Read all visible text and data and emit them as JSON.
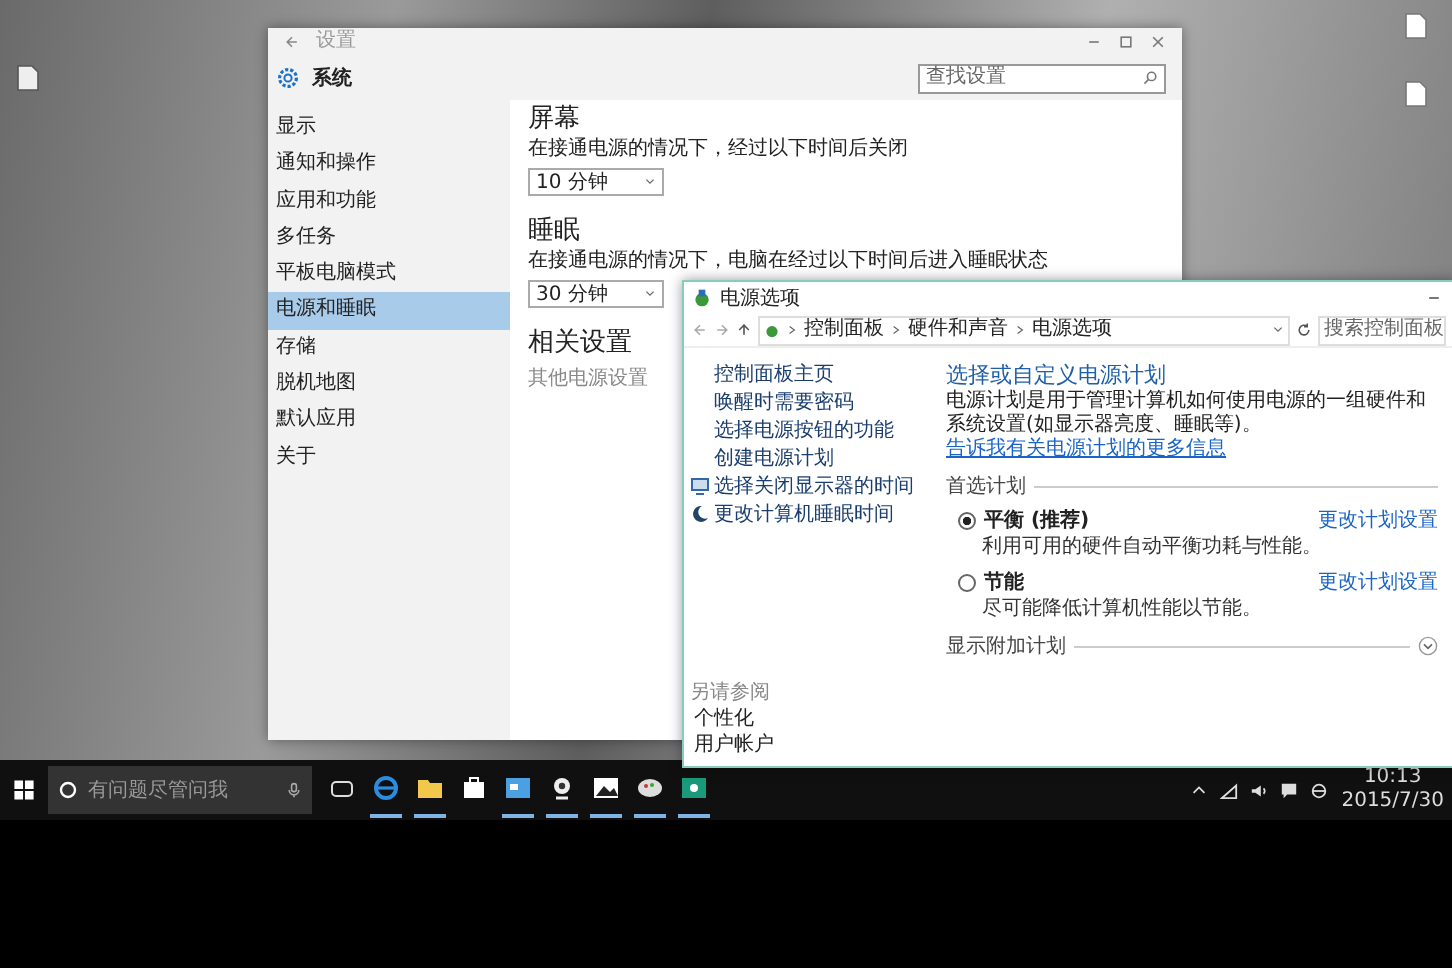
{
  "settings_window": {
    "title": "设置",
    "header": "系统",
    "search": {
      "placeholder": "查找设置"
    },
    "sidebar": {
      "items": [
        {
          "label": "显示",
          "selected": false
        },
        {
          "label": "通知和操作",
          "selected": false
        },
        {
          "label": "应用和功能",
          "selected": false
        },
        {
          "label": "多任务",
          "selected": false
        },
        {
          "label": "平板电脑模式",
          "selected": false
        },
        {
          "label": "电源和睡眠",
          "selected": true
        },
        {
          "label": "存储",
          "selected": false
        },
        {
          "label": "脱机地图",
          "selected": false
        },
        {
          "label": "默认应用",
          "selected": false
        },
        {
          "label": "关于",
          "selected": false
        }
      ]
    },
    "sections": [
      {
        "heading": "屏幕",
        "label": "在接通电源的情况下，经过以下时间后关闭",
        "dropdown": "10 分钟"
      },
      {
        "heading": "睡眠",
        "label": "在接通电源的情况下，电脑在经过以下时间后进入睡眠状态",
        "dropdown": "30 分钟"
      }
    ],
    "related": {
      "heading": "相关设置",
      "link": "其他电源设置"
    }
  },
  "control_panel": {
    "title": "电源选项",
    "breadcrumb": [
      "控制面板",
      "硬件和声音",
      "电源选项"
    ],
    "search": {
      "placeholder": "搜索控制面板"
    },
    "tasks": [
      {
        "label": "控制面板主页",
        "kind": "plain"
      },
      {
        "label": "唤醒时需要密码",
        "kind": "plain"
      },
      {
        "label": "选择电源按钮的功能",
        "kind": "plain"
      },
      {
        "label": "创建电源计划",
        "kind": "plain"
      },
      {
        "label": "选择关闭显示器的时间",
        "kind": "monitor"
      },
      {
        "label": "更改计算机睡眠时间",
        "kind": "sleep"
      }
    ],
    "see_also": {
      "heading": "另请参阅",
      "links": [
        "个性化",
        "用户帐户"
      ]
    },
    "heading": "选择或自定义电源计划",
    "description": "电源计划是用于管理计算机如何使用电源的一组硬件和系统设置(如显示器亮度、睡眠等)。",
    "more_link": "告诉我有关电源计划的更多信息",
    "group_label": "首选计划",
    "plans": [
      {
        "name": "平衡 (推荐)",
        "selected": true,
        "description": "利用可用的硬件自动平衡功耗与性能。",
        "link": "更改计划设置"
      },
      {
        "name": "节能",
        "selected": false,
        "description": "尽可能降低计算机性能以节能。",
        "link": "更改计划设置"
      }
    ],
    "additional": "显示附加计划"
  },
  "taskbar": {
    "search": {
      "placeholder": "有问题尽管问我"
    },
    "apps": [
      {
        "kind": "browser",
        "running": true
      },
      {
        "kind": "folder",
        "running": true
      },
      {
        "kind": "store",
        "running": false
      },
      {
        "kind": "control-panel",
        "running": true
      },
      {
        "kind": "webcam",
        "running": true
      },
      {
        "kind": "photos",
        "running": true
      },
      {
        "kind": "paint",
        "running": true
      },
      {
        "kind": "green-app",
        "running": true
      }
    ],
    "time": "10:13",
    "date": "2015/7/30"
  }
}
